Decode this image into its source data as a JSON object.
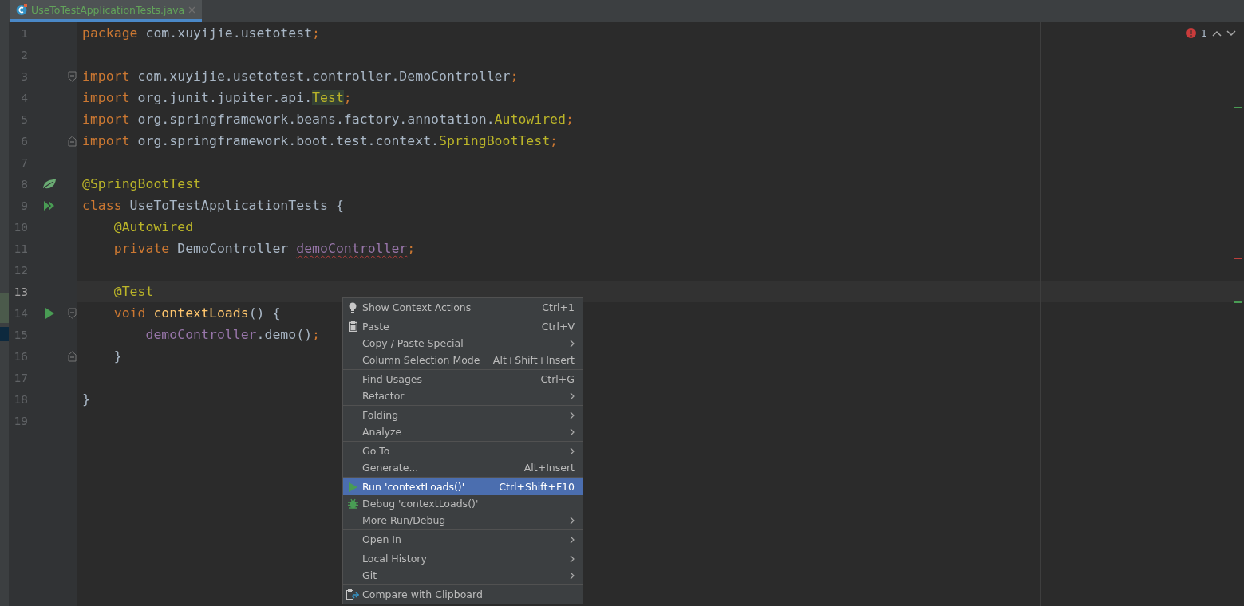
{
  "tab": {
    "title": "UseToTestApplicationTests.java",
    "selected": true
  },
  "inspections": {
    "errors": "1"
  },
  "lines": [
    {
      "number": "1",
      "current": false,
      "tokens": [
        {
          "text": "package",
          "kind": "kw"
        },
        {
          "text": " com.xuyijie.usetotest",
          "kind": "plain"
        },
        {
          "text": ";",
          "kind": "punct"
        }
      ]
    },
    {
      "number": "2",
      "current": false
    },
    {
      "number": "3",
      "current": false,
      "fold": {
        "kind": "start"
      },
      "tokens": [
        {
          "text": "import",
          "kind": "kw"
        },
        {
          "text": " com.xuyijie.usetotest.controller.DemoController",
          "kind": "plain"
        },
        {
          "text": ";",
          "kind": "punct"
        }
      ]
    },
    {
      "number": "4",
      "current": false,
      "tokens": [
        {
          "text": "import",
          "kind": "kw"
        },
        {
          "text": " org.junit.jupiter.api.",
          "kind": "plain"
        },
        {
          "text": "Test",
          "kind": "match"
        },
        {
          "text": ";",
          "kind": "punct"
        }
      ]
    },
    {
      "number": "5",
      "current": false,
      "tokens": [
        {
          "text": "import",
          "kind": "kw"
        },
        {
          "text": " org.springframework.beans.factory.annotation.",
          "kind": "plain"
        },
        {
          "text": "Autowired",
          "kind": "ann"
        },
        {
          "text": ";",
          "kind": "punct"
        }
      ]
    },
    {
      "number": "6",
      "current": false,
      "fold": {
        "kind": "end"
      },
      "tokens": [
        {
          "text": "import",
          "kind": "kw"
        },
        {
          "text": " org.springframework.boot.test.context.",
          "kind": "plain"
        },
        {
          "text": "SpringBootTest",
          "kind": "ann"
        },
        {
          "text": ";",
          "kind": "punct"
        }
      ]
    },
    {
      "number": "7",
      "current": false
    },
    {
      "number": "8",
      "current": false,
      "gutter": {
        "kind": "spring"
      },
      "tokens": [
        {
          "text": "@SpringBootTest",
          "kind": "ann"
        }
      ]
    },
    {
      "number": "9",
      "current": false,
      "gutter": {
        "kind": "run-all"
      },
      "tokens": [
        {
          "text": "class",
          "kind": "kw"
        },
        {
          "text": " UseToTestApplicationTests {",
          "kind": "plain"
        }
      ]
    },
    {
      "number": "10",
      "current": false,
      "tokens": [
        {
          "text": "    @Autowired",
          "kind": "ann"
        }
      ]
    },
    {
      "number": "11",
      "current": false,
      "tokens": [
        {
          "text": "    private",
          "kind": "kw"
        },
        {
          "text": " DemoController ",
          "kind": "plain"
        },
        {
          "text": "demoController",
          "kind": "field",
          "error": true
        },
        {
          "text": ";",
          "kind": "punct"
        }
      ]
    },
    {
      "number": "12",
      "current": false
    },
    {
      "number": "13",
      "current": true,
      "tokens": [
        {
          "text": "    @Test",
          "kind": "ann"
        }
      ]
    },
    {
      "number": "14",
      "current": false,
      "gutter": {
        "kind": "run"
      },
      "fold": {
        "kind": "start"
      },
      "tokens": [
        {
          "text": "    void",
          "kind": "kw"
        },
        {
          "text": " contextLoads",
          "kind": "method"
        },
        {
          "text": "() {",
          "kind": "plain"
        }
      ]
    },
    {
      "number": "15",
      "current": false,
      "tokens": [
        {
          "text": "        demoController",
          "kind": "field"
        },
        {
          "text": ".demo()",
          "kind": "plain"
        },
        {
          "text": ";",
          "kind": "punct"
        }
      ]
    },
    {
      "number": "16",
      "current": false,
      "fold": {
        "kind": "end"
      },
      "tokens": [
        {
          "text": "    }",
          "kind": "plain"
        }
      ]
    },
    {
      "number": "17",
      "current": false
    },
    {
      "number": "18",
      "current": false,
      "tokens": [
        {
          "text": "}",
          "kind": "plain"
        }
      ]
    },
    {
      "number": "19",
      "current": false
    }
  ],
  "context_menu": {
    "groups": [
      [
        {
          "label": "Show Context Actions",
          "kind": "bulb",
          "shortcut": "Ctrl+1",
          "submenu": false,
          "selected": false
        }
      ],
      [
        {
          "label": "Paste",
          "kind": "clipboard",
          "shortcut": "Ctrl+V",
          "submenu": false,
          "selected": false
        },
        {
          "label": "Copy / Paste Special",
          "submenu": true,
          "selected": false
        },
        {
          "label": "Column Selection Mode",
          "shortcut": "Alt+Shift+Insert",
          "submenu": false,
          "selected": false
        }
      ],
      [
        {
          "label": "Find Usages",
          "shortcut": "Ctrl+G",
          "submenu": false,
          "selected": false
        },
        {
          "label": "Refactor",
          "submenu": true,
          "selected": false
        }
      ],
      [
        {
          "label": "Folding",
          "submenu": true,
          "selected": false
        },
        {
          "label": "Analyze",
          "submenu": true,
          "selected": false
        }
      ],
      [
        {
          "label": "Go To",
          "submenu": true,
          "selected": false
        },
        {
          "label": "Generate...",
          "shortcut": "Alt+Insert",
          "submenu": false,
          "selected": false
        }
      ],
      [
        {
          "label": "Run 'contextLoads()'",
          "kind": "run",
          "shortcut": "Ctrl+Shift+F10",
          "submenu": false,
          "selected": true
        },
        {
          "label": "Debug 'contextLoads()'",
          "kind": "bug",
          "submenu": false,
          "selected": false
        },
        {
          "label": "More Run/Debug",
          "submenu": true,
          "selected": false
        }
      ],
      [
        {
          "label": "Open In",
          "submenu": true,
          "selected": false
        }
      ],
      [
        {
          "label": "Local History",
          "submenu": true,
          "selected": false
        },
        {
          "label": "Git",
          "submenu": true,
          "selected": false
        }
      ],
      [
        {
          "label": "Compare with Clipboard",
          "kind": "compare",
          "submenu": false,
          "selected": false
        }
      ]
    ]
  }
}
